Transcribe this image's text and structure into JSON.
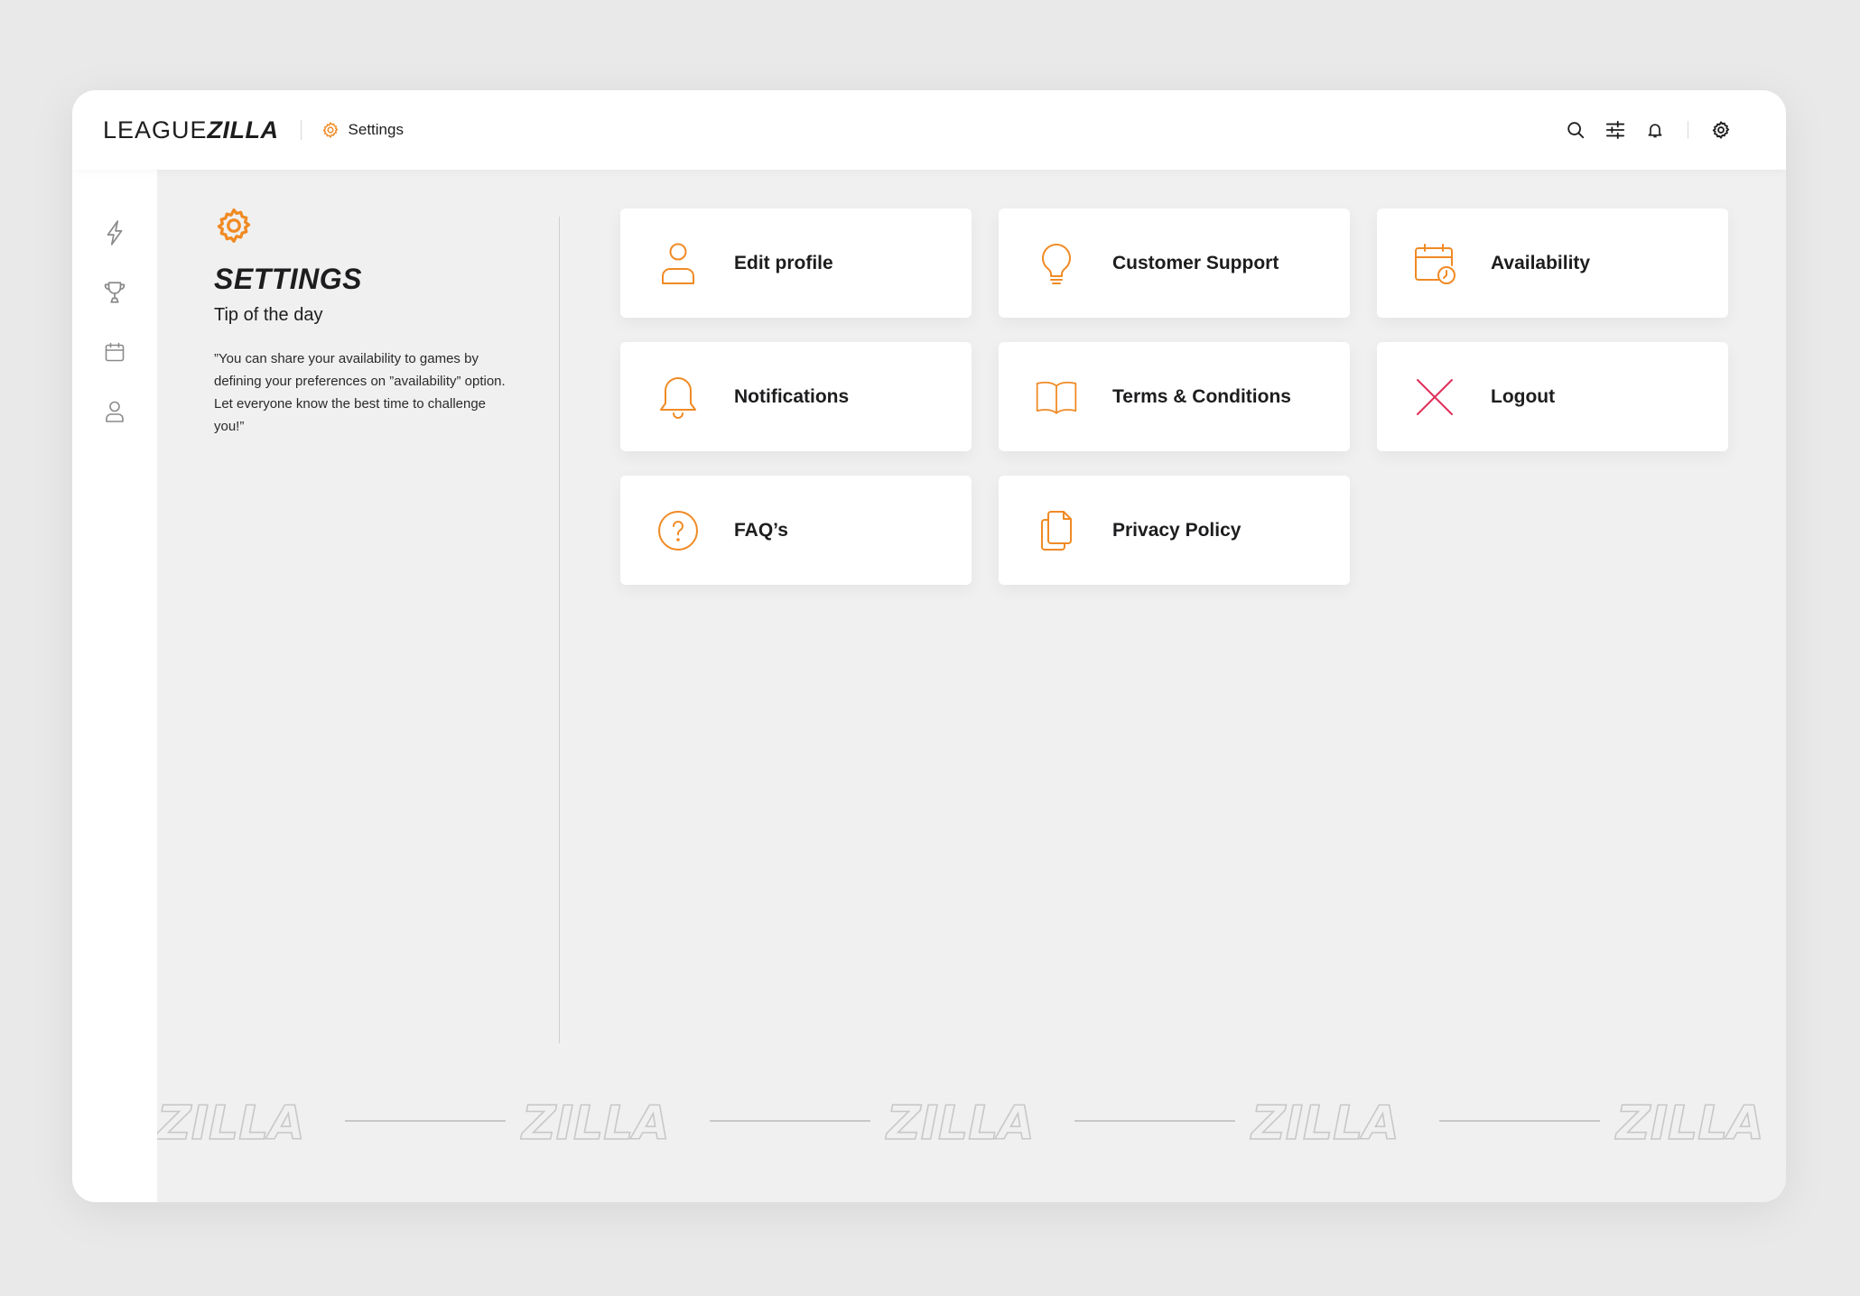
{
  "app": {
    "logo_part1": "LEAGUE",
    "logo_part2": "ZILLA",
    "breadcrumb": "Settings"
  },
  "colors": {
    "accent": "#f08a24",
    "danger": "#e0305a",
    "text": "#1d1d1f"
  },
  "header_icons": [
    "search-icon",
    "filter-icon",
    "bell-icon",
    "gear-icon"
  ],
  "sidebar": {
    "items": [
      {
        "icon": "lightning-icon"
      },
      {
        "icon": "trophy-icon"
      },
      {
        "icon": "calendar-icon"
      },
      {
        "icon": "user-icon"
      }
    ]
  },
  "settings_panel": {
    "title": "SETTINGS",
    "subtitle": "Tip of the day",
    "tip": "”You can share your availability to games by defining your preferences on ”availability” option. Let everyone know the best time to challenge you!”"
  },
  "tiles": [
    {
      "label": "Edit profile",
      "icon": "user-icon"
    },
    {
      "label": "Customer Support",
      "icon": "lightbulb-icon"
    },
    {
      "label": "Availability",
      "icon": "calendar-clock-icon"
    },
    {
      "label": "Notifications",
      "icon": "bell-icon"
    },
    {
      "label": "Terms & Conditions",
      "icon": "book-icon"
    },
    {
      "label": "Logout",
      "icon": "close-icon"
    },
    {
      "label": "FAQ’s",
      "icon": "question-icon"
    },
    {
      "label": "Privacy Policy",
      "icon": "documents-icon"
    }
  ],
  "watermark": {
    "word": "ZILLA"
  }
}
